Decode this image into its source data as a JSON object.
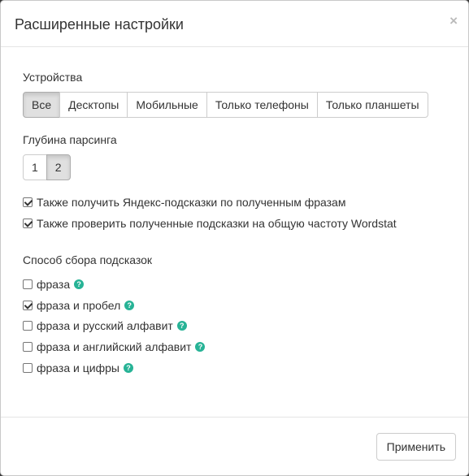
{
  "modal": {
    "title": "Расширенные настройки",
    "close_label": "×"
  },
  "devices": {
    "label": "Устройства",
    "options": [
      "Все",
      "Десктопы",
      "Мобильные",
      "Только телефоны",
      "Только планшеты"
    ],
    "selected": "Все"
  },
  "depth": {
    "label": "Глубина парсинга",
    "options": [
      "1",
      "2"
    ],
    "selected": "2"
  },
  "options": [
    {
      "label": "Также получить Яндекс-подсказки по полученным фразам",
      "checked": true
    },
    {
      "label": "Также проверить полученные подсказки на общую частоту Wordstat",
      "checked": true
    }
  ],
  "method": {
    "label": "Способ сбора подсказок",
    "items": [
      {
        "label": "фраза",
        "checked": false
      },
      {
        "label": "фраза и пробел",
        "checked": true
      },
      {
        "label": "фраза и русский алфавит",
        "checked": false
      },
      {
        "label": "фраза и английский алфавит",
        "checked": false
      },
      {
        "label": "фраза и цифры",
        "checked": false
      }
    ]
  },
  "footer": {
    "apply_label": "Применить"
  },
  "colors": {
    "help_icon": "#27b396",
    "active_button": "#e0e0e0"
  },
  "icons": {
    "help": "question-circle-icon",
    "checkbox_checked": "checkmark-icon"
  }
}
